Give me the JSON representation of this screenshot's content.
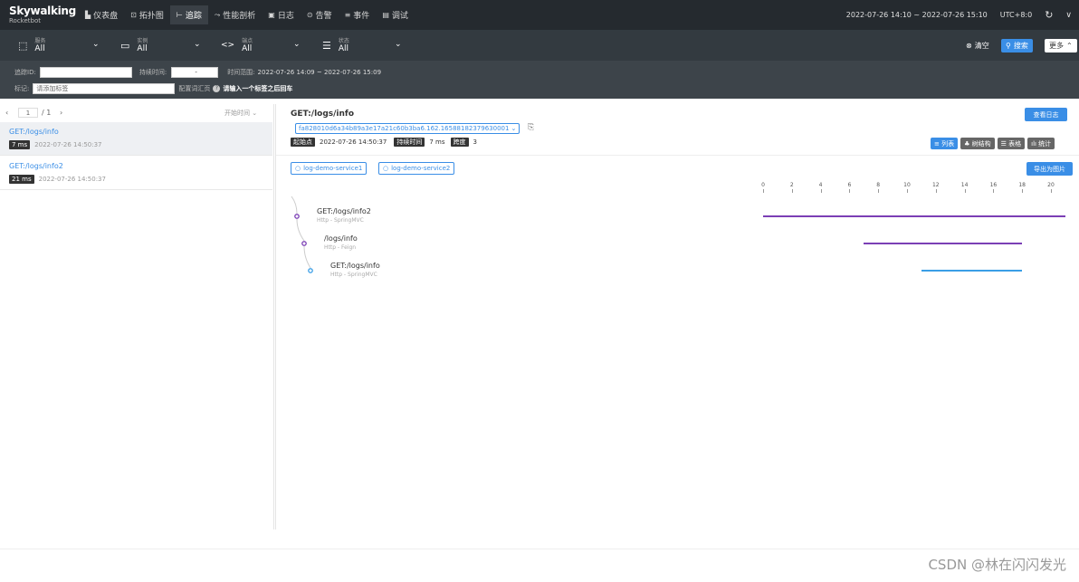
{
  "header": {
    "logo_title": "Skywalking",
    "logo_subtitle": "Rocketbot",
    "menu": [
      {
        "icon": "chart-icon",
        "glyph": "▙",
        "label": "仪表盘"
      },
      {
        "icon": "topology-icon",
        "glyph": "⊡",
        "label": "拓扑图"
      },
      {
        "icon": "trace-icon",
        "glyph": "⊢",
        "label": "追踪"
      },
      {
        "icon": "profile-icon",
        "glyph": "⤳",
        "label": "性能剖析"
      },
      {
        "icon": "log-icon",
        "glyph": "▣",
        "label": "日志"
      },
      {
        "icon": "alarm-icon",
        "glyph": "⊙",
        "label": "告警"
      },
      {
        "icon": "event-icon",
        "glyph": "≡",
        "label": "事件"
      },
      {
        "icon": "debug-icon",
        "glyph": "▤",
        "label": "调试"
      }
    ],
    "time_range": "2022-07-26 14:10 ~ 2022-07-26 15:10",
    "timezone": "UTC+8:0"
  },
  "filters": {
    "service": {
      "label": "服务",
      "value": "All"
    },
    "instance": {
      "label": "实例",
      "value": "All"
    },
    "endpoint": {
      "label": "端点",
      "value": "All"
    },
    "status": {
      "label": "状态",
      "value": "All"
    },
    "clear_label": "清空",
    "search_label": "搜索",
    "more_label": "更多"
  },
  "conditions": {
    "trace_id_label": "追踪ID:",
    "trace_id_value": "",
    "duration_label": "持续时间:",
    "duration_sep": "-",
    "time_range_label": "时间范围:",
    "time_range_value": "2022-07-26 14:09 ~ 2022-07-26 15:09",
    "tags_label": "标记:",
    "tags_placeholder": "请添加标签",
    "tags_hint_label": "配置词汇页",
    "tags_hint": "请输入一个标签之后回车"
  },
  "trace_list": {
    "pager_current": "1",
    "pager_total": "/ 1",
    "sort_label": "开始时间",
    "items": [
      {
        "name": "GET:/logs/info",
        "duration": "7 ms",
        "time": "2022-07-26 14:50:37"
      },
      {
        "name": "GET:/logs/info2",
        "duration": "21 ms",
        "time": "2022-07-26 14:50:37"
      }
    ]
  },
  "detail": {
    "title": "GET:/logs/info",
    "view_logs_label": "查看日志",
    "trace_id": "fa828010d6a34b89a3e17a21c60b3ba6.162.16588182379630001",
    "start_label": "起始点",
    "start_value": "2022-07-26 14:50:37",
    "duration_label": "持续时间",
    "duration_value": "7 ms",
    "span_label": "跨度",
    "span_value": "3",
    "view_buttons": [
      "≡ 列表",
      "♣ 树结构",
      "☰ 表格",
      "ılı 统计"
    ],
    "services": [
      "log-demo-service1",
      "log-demo-service2"
    ],
    "export_label": "导出为图片",
    "axis_ticks": [
      "0",
      "2",
      "4",
      "6",
      "8",
      "10",
      "12",
      "14",
      "16",
      "18",
      "20"
    ],
    "spans": [
      {
        "name": "GET:/logs/info2",
        "type": "Http - SpringMVC",
        "color": "#7b3fb5",
        "start": 0,
        "end": 21
      },
      {
        "name": "/logs/info",
        "type": "Http - Feign",
        "color": "#7b3fb5",
        "start": 7,
        "end": 18
      },
      {
        "name": "GET:/logs/info",
        "type": "Http - SpringMVC",
        "color": "#3a9ee6",
        "start": 11,
        "end": 18
      }
    ]
  },
  "footer": {
    "watermark": "CSDN @林在闪闪发光"
  }
}
